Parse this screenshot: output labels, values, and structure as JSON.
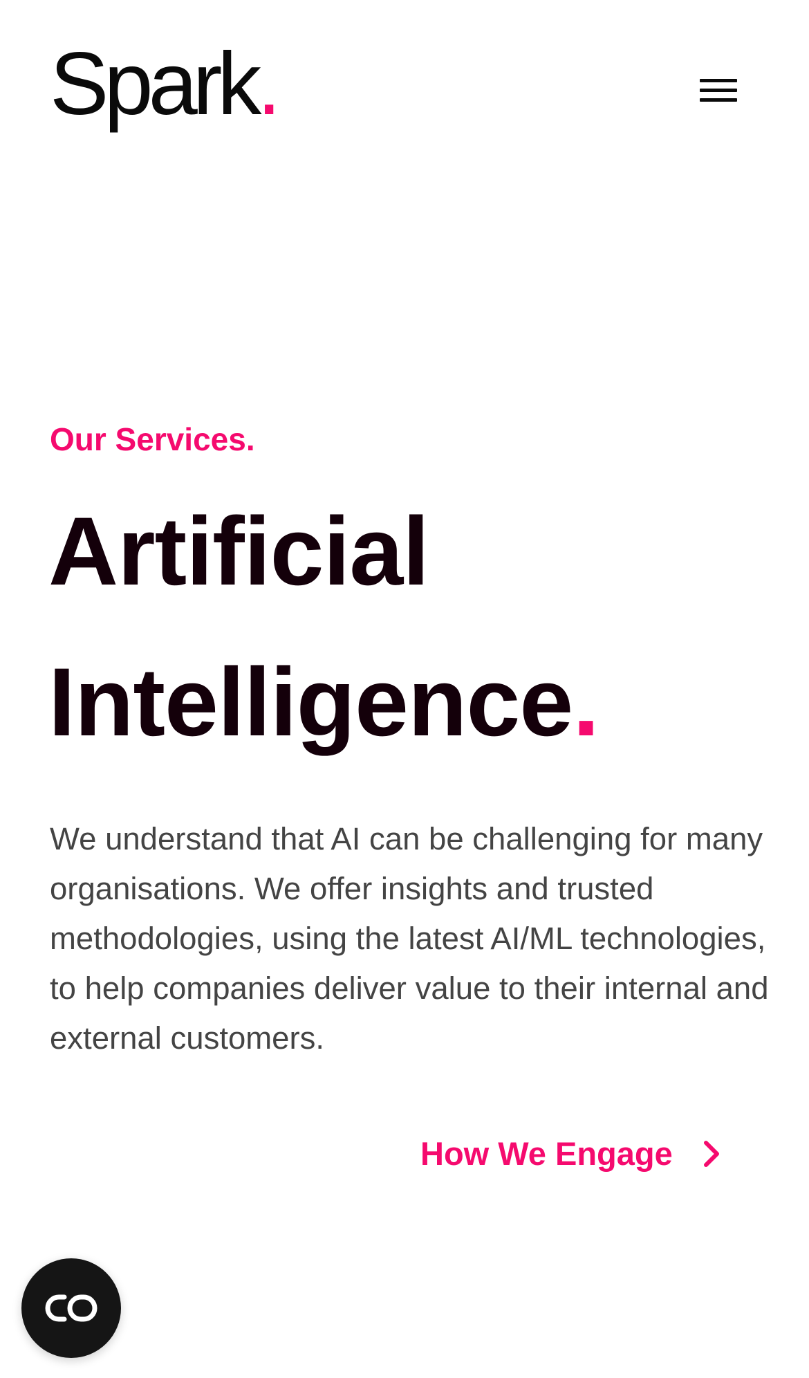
{
  "header": {
    "logo_text": "Spark",
    "logo_dot": ".",
    "menu_icon": "hamburger-menu-icon"
  },
  "hero": {
    "eyebrow": "Our Services.",
    "title_line1": "Artificial",
    "title_line2": "Intelligence",
    "title_dot": ".",
    "body": "We understand that AI can be challenging for many organisations. We offer insights and trusted methodologies, using the latest AI/ML technologies, to help companies deliver value to their internal and external customers.",
    "cta_label": "How We Engage",
    "cta_icon": "chevron-right-icon"
  },
  "widget": {
    "icon": "link-toggle-icon"
  },
  "colors": {
    "accent": "#f50a6e",
    "heading": "#14000a",
    "body_text": "#444444",
    "widget_bg": "#151515",
    "background": "#ffffff"
  }
}
